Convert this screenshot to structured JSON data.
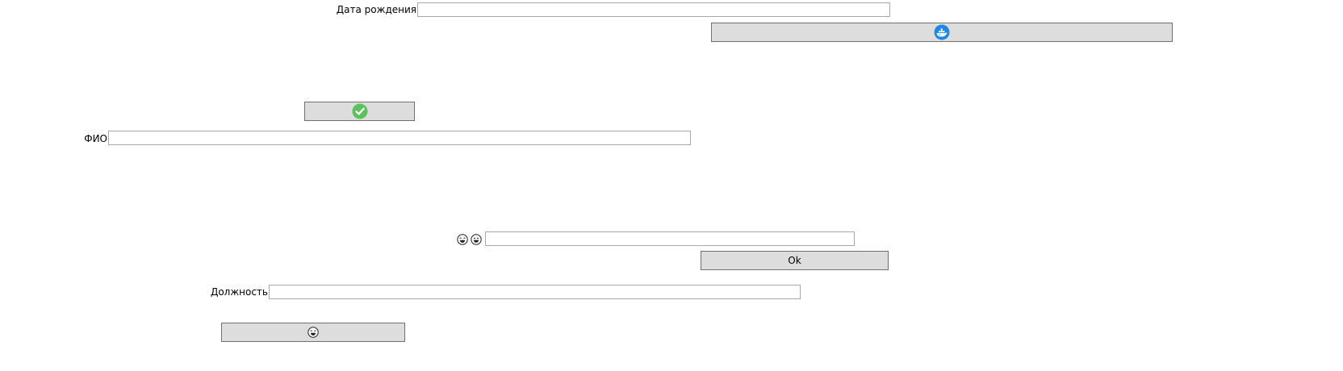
{
  "form": {
    "birth_date": {
      "label": "Дата рождения",
      "value": ""
    },
    "fio": {
      "label": "ФИО",
      "value": ""
    },
    "emoji_field": {
      "value": ""
    },
    "position": {
      "label": "Должность",
      "value": ""
    }
  },
  "buttons": {
    "ok_label": "Ok"
  },
  "icons": {
    "whale_button": "docker-whale-icon",
    "check_button": "green-check-icon",
    "emoji_label_1": "laughing-face-icon",
    "emoji_label_2": "grinning-face-icon",
    "emoji_button": "laughing-face-icon"
  },
  "colors": {
    "button_bg": "#dddddd",
    "field_border": "#a9a9a9",
    "check_green": "#5cc05c",
    "whale_blue": "#1e88e5"
  }
}
